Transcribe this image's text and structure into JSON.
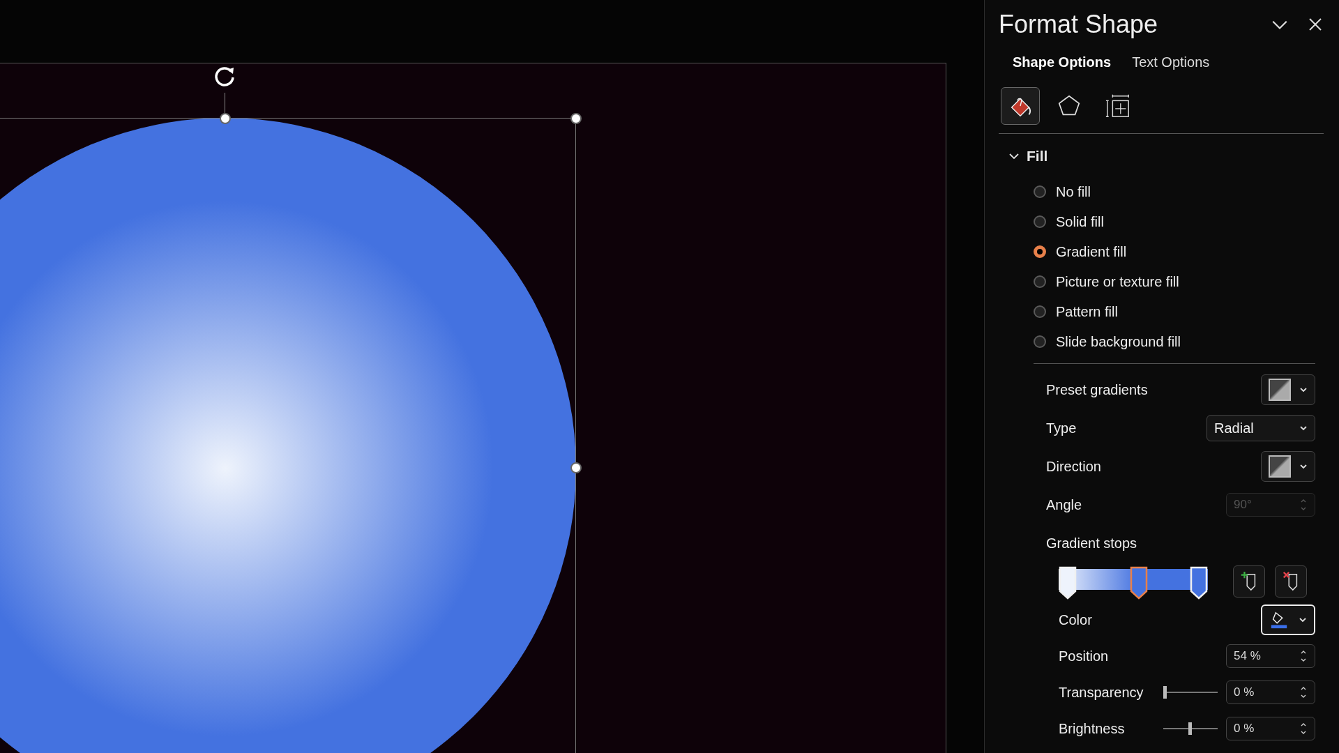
{
  "panel": {
    "title": "Format Shape",
    "tabs": [
      {
        "label": "Shape Options",
        "selected": true
      },
      {
        "label": "Text Options",
        "selected": false
      }
    ],
    "icon_tabs": [
      {
        "kind": "fill",
        "selected": true
      },
      {
        "kind": "effects",
        "selected": false
      },
      {
        "kind": "size",
        "selected": false
      }
    ],
    "section": {
      "title": "Fill",
      "expanded": true
    },
    "fill_options": [
      {
        "label": "No fill",
        "selected": false
      },
      {
        "label": "Solid fill",
        "selected": false
      },
      {
        "label": "Gradient fill",
        "selected": true
      },
      {
        "label": "Picture or texture fill",
        "selected": false
      },
      {
        "label": "Pattern fill",
        "selected": false
      },
      {
        "label": "Slide background fill",
        "selected": false
      }
    ],
    "preset_gradients": {
      "label": "Preset gradients"
    },
    "type": {
      "label": "Type",
      "value": "Radial"
    },
    "direction": {
      "label": "Direction"
    },
    "angle": {
      "label": "Angle",
      "value": "90°",
      "disabled": true
    },
    "gradient_stops": {
      "label": "Gradient stops",
      "stops": [
        {
          "level": 0,
          "selected": false,
          "color": "#eef3fc"
        },
        {
          "level": 0.54,
          "selected": true,
          "color": "#4472e0"
        },
        {
          "level": 1,
          "selected": false,
          "color": "#4472e0"
        }
      ]
    },
    "color": {
      "label": "Color",
      "color": "#3a6ee8"
    },
    "position": {
      "label": "Position",
      "value": "54 %"
    },
    "transparency": {
      "label": "Transparency",
      "value": "0 %",
      "level": 0
    },
    "brightness": {
      "label": "Brightness",
      "value": "0 %",
      "level": 0.5
    }
  }
}
